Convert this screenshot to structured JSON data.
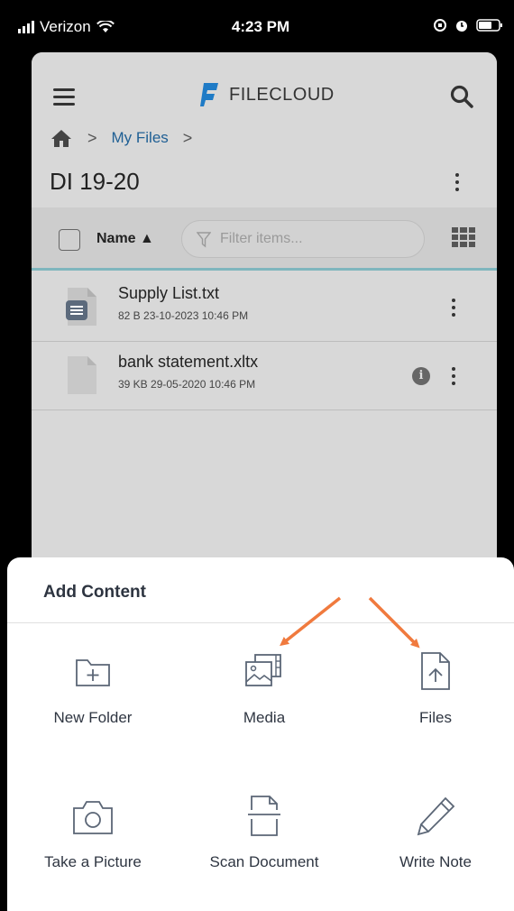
{
  "status": {
    "carrier": "Verizon",
    "time": "4:23 PM"
  },
  "header": {
    "logo_text": "FILECLOUD"
  },
  "breadcrumb": {
    "current": "My Files"
  },
  "folder": {
    "title": "DI 19-20"
  },
  "toolbar": {
    "sort_label": "Name ▲",
    "filter_placeholder": "Filter items..."
  },
  "files": [
    {
      "name": "Supply List.txt",
      "meta": "82 B 23-10-2023 10:46 PM"
    },
    {
      "name": "bank statement.xltx",
      "meta": "39 KB 29-05-2020 10:46 PM"
    }
  ],
  "add_content": {
    "title": "Add Content",
    "actions": [
      {
        "label": "New Folder",
        "icon": "folder-plus-icon"
      },
      {
        "label": "Media",
        "icon": "media-icon"
      },
      {
        "label": "Files",
        "icon": "file-upload-icon"
      },
      {
        "label": "Take a Picture",
        "icon": "camera-icon"
      },
      {
        "label": "Scan Document",
        "icon": "scan-document-icon"
      },
      {
        "label": "Write Note",
        "icon": "pencil-icon"
      }
    ]
  },
  "colors": {
    "accent": "#1f5f94",
    "arrow": "#f07a3e",
    "toolbar_border": "#7fb6bd"
  }
}
